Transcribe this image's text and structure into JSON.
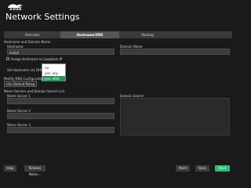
{
  "brand": {
    "logo_text": "SUSE"
  },
  "window": {
    "title": "Network Settings"
  },
  "tabs": [
    {
      "label": "Overview",
      "selected": false
    },
    {
      "label": "Hostname/DNS",
      "selected": true
    },
    {
      "label": "Routing",
      "selected": false
    }
  ],
  "hostname_section": {
    "heading": "Hostname and Domain Name",
    "hostname_label": "Hostname",
    "hostname_value": "install",
    "domain_label": "Domain Name",
    "domain_value": "",
    "assign_loopback_label": "Assign Hostname to Loopback IP",
    "assign_loopback_checked": false,
    "set_dhcp_label": "Set Hostname via DHCP",
    "dhcp_options": [
      "no",
      "yes: any",
      "yes: eth0"
    ],
    "dhcp_selected": "yes: eth0"
  },
  "dns_section": {
    "modify_label": "Modify DNS Configuration",
    "policy_value": "Use Default Policy",
    "heading": "Name Servers and Domain Search List",
    "ns1_label": "Name Server 1",
    "ns2_label": "Name Server 2",
    "ns3_label": "Name Server 3",
    "domain_search_label": "Domain Search"
  },
  "buttons": {
    "help": "Help",
    "release_notes": "Release Notes...",
    "abort": "Abort",
    "back": "Back",
    "next": "Next"
  },
  "colors": {
    "accent": "#30ba78",
    "selection": "#2d8f5b",
    "background": "#1a1a1a"
  }
}
